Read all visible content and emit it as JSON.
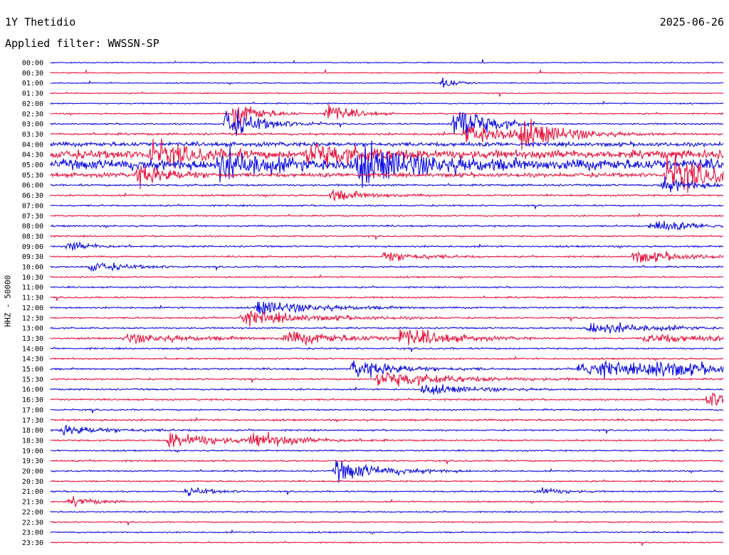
{
  "header": {
    "station": "1Y Thetidio",
    "date": "2025-06-26",
    "filter": "Applied filter: WWSSN-SP"
  },
  "colors": {
    "trace_even": "#1010e0",
    "trace_odd": "#e8163f",
    "background": "#ffffff"
  },
  "chart_data": {
    "type": "line",
    "title": "1Y Thetidio",
    "subtitle": "Applied filter: WWSSN-SP",
    "ylabel": "HHZ - 50000",
    "xlabel": "",
    "grid": false,
    "legend": "none",
    "row_minutes": 30,
    "rows": [
      "00:00",
      "00:30",
      "01:00",
      "01:30",
      "02:00",
      "02:30",
      "03:00",
      "03:30",
      "04:00",
      "04:30",
      "05:00",
      "05:30",
      "06:00",
      "06:30",
      "07:00",
      "07:30",
      "08:00",
      "08:30",
      "09:00",
      "09:30",
      "10:00",
      "10:30",
      "11:00",
      "11:30",
      "12:00",
      "12:30",
      "13:00",
      "13:30",
      "14:00",
      "14:30",
      "15:00",
      "15:30",
      "16:00",
      "16:30",
      "17:00",
      "17:30",
      "18:00",
      "18:30",
      "19:00",
      "19:30",
      "20:00",
      "20:30",
      "21:00",
      "21:30",
      "22:00",
      "22:30",
      "23:00",
      "23:30"
    ],
    "row_noise": [
      1,
      1,
      1,
      1,
      1.2,
      1.2,
      1.5,
      2,
      4,
      8,
      10,
      4,
      1.8,
      1.6,
      1.5,
      1.4,
      1.6,
      1.4,
      1.6,
      1.5,
      1.5,
      1.4,
      1.4,
      1.6,
      1.6,
      1.6,
      1.5,
      1.7,
      1.6,
      1.5,
      1.7,
      1.6,
      1.6,
      1.6,
      1.5,
      1.8,
      1.5,
      1.5,
      1.4,
      1.5,
      1.4,
      1.4,
      1.4,
      1.3,
      1.2,
      1.2,
      1.3,
      1.1
    ],
    "events": [
      {
        "row": 2,
        "minute": 17.5,
        "amp": 14,
        "dur": 0.5
      },
      {
        "row": 5,
        "minute": 8.2,
        "amp": 28,
        "dur": 1
      },
      {
        "row": 5,
        "minute": 12.3,
        "amp": 22,
        "dur": 1
      },
      {
        "row": 6,
        "minute": 7.8,
        "amp": 30,
        "dur": 1.5
      },
      {
        "row": 6,
        "minute": 18,
        "amp": 50,
        "dur": 1.2
      },
      {
        "row": 7,
        "minute": 18.5,
        "amp": 25,
        "dur": 2
      },
      {
        "row": 7,
        "minute": 21,
        "amp": 20,
        "dur": 2
      },
      {
        "row": 9,
        "minute": 4.5,
        "amp": 25,
        "dur": 1.5
      },
      {
        "row": 9,
        "minute": 11.5,
        "amp": 22,
        "dur": 2
      },
      {
        "row": 10,
        "minute": 7.5,
        "amp": 25,
        "dur": 2
      },
      {
        "row": 10,
        "minute": 13.7,
        "amp": 35,
        "dur": 2.5
      },
      {
        "row": 11,
        "minute": 3.9,
        "amp": 20,
        "dur": 1.5
      },
      {
        "row": 11,
        "minute": 27.5,
        "amp": 40,
        "dur": 2
      },
      {
        "row": 12,
        "minute": 27.3,
        "amp": 15,
        "dur": 1.5
      },
      {
        "row": 13,
        "minute": 12.5,
        "amp": 12,
        "dur": 1.5
      },
      {
        "row": 16,
        "minute": 26.8,
        "amp": 12,
        "dur": 2
      },
      {
        "row": 18,
        "minute": 0.8,
        "amp": 10,
        "dur": 1
      },
      {
        "row": 19,
        "minute": 14.9,
        "amp": 12,
        "dur": 1.5
      },
      {
        "row": 19,
        "minute": 26,
        "amp": 14,
        "dur": 2
      },
      {
        "row": 20,
        "minute": 1.8,
        "amp": 10,
        "dur": 1.5
      },
      {
        "row": 24,
        "minute": 9.2,
        "amp": 14,
        "dur": 2.5
      },
      {
        "row": 25,
        "minute": 8.5,
        "amp": 14,
        "dur": 3
      },
      {
        "row": 26,
        "minute": 24,
        "amp": 13,
        "dur": 2.5
      },
      {
        "row": 27,
        "minute": 3.3,
        "amp": 9,
        "dur": 3
      },
      {
        "row": 27,
        "minute": 10.5,
        "amp": 12,
        "dur": 3
      },
      {
        "row": 27,
        "minute": 15.6,
        "amp": 18,
        "dur": 2
      },
      {
        "row": 27,
        "minute": 26.5,
        "amp": 10,
        "dur": 3
      },
      {
        "row": 30,
        "minute": 13.5,
        "amp": 18,
        "dur": 2
      },
      {
        "row": 30,
        "minute": 23.6,
        "amp": 20,
        "dur": 3
      },
      {
        "row": 30,
        "minute": 26.7,
        "amp": 14,
        "dur": 3
      },
      {
        "row": 31,
        "minute": 14.6,
        "amp": 16,
        "dur": 3
      },
      {
        "row": 32,
        "minute": 16.6,
        "amp": 10,
        "dur": 2
      },
      {
        "row": 33,
        "minute": 29.3,
        "amp": 16,
        "dur": 2
      },
      {
        "row": 36,
        "minute": 0.5,
        "amp": 10,
        "dur": 2
      },
      {
        "row": 37,
        "minute": 5.3,
        "amp": 18,
        "dur": 2
      },
      {
        "row": 37,
        "minute": 9,
        "amp": 14,
        "dur": 2
      },
      {
        "row": 40,
        "minute": 12.7,
        "amp": 22,
        "dur": 2
      },
      {
        "row": 42,
        "minute": 6.1,
        "amp": 9,
        "dur": 1
      },
      {
        "row": 42,
        "minute": 21.7,
        "amp": 9,
        "dur": 1
      },
      {
        "row": 43,
        "minute": 0.9,
        "amp": 10,
        "dur": 1
      }
    ]
  }
}
